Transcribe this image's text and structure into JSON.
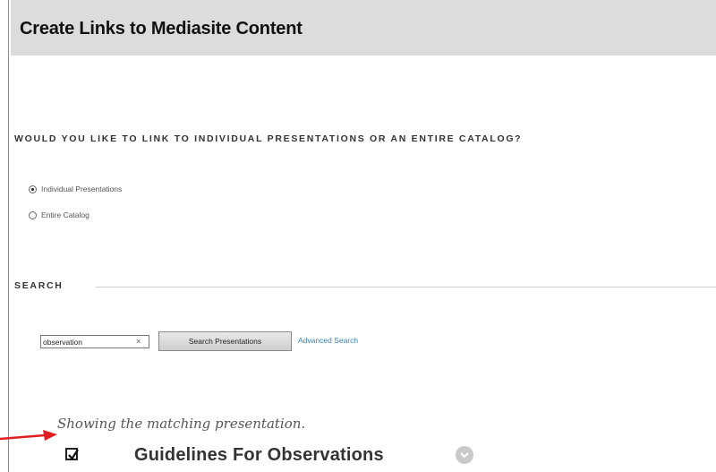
{
  "header": {
    "title": "Create Links to Mediasite Content"
  },
  "link_choice": {
    "question": "WOULD YOU LIKE TO LINK TO INDIVIDUAL PRESENTATIONS OR AN ENTIRE CATALOG?",
    "options": [
      {
        "label": "Individual Presentations",
        "selected": true
      },
      {
        "label": "Entire Catalog",
        "selected": false
      }
    ]
  },
  "search": {
    "section_label": "SEARCH",
    "input_value": "observation",
    "clear_symbol": "×",
    "button_label": "Search Presentations",
    "advanced_link": "Advanced Search"
  },
  "results": {
    "message": "Showing the matching presentation.",
    "items": [
      {
        "title": "Guidelines For Observations",
        "checked": true
      }
    ]
  },
  "annotation": {
    "arrow_color": "#e02020"
  },
  "colors": {
    "header_bg": "#dcdcdc",
    "link": "#3c7fae"
  }
}
